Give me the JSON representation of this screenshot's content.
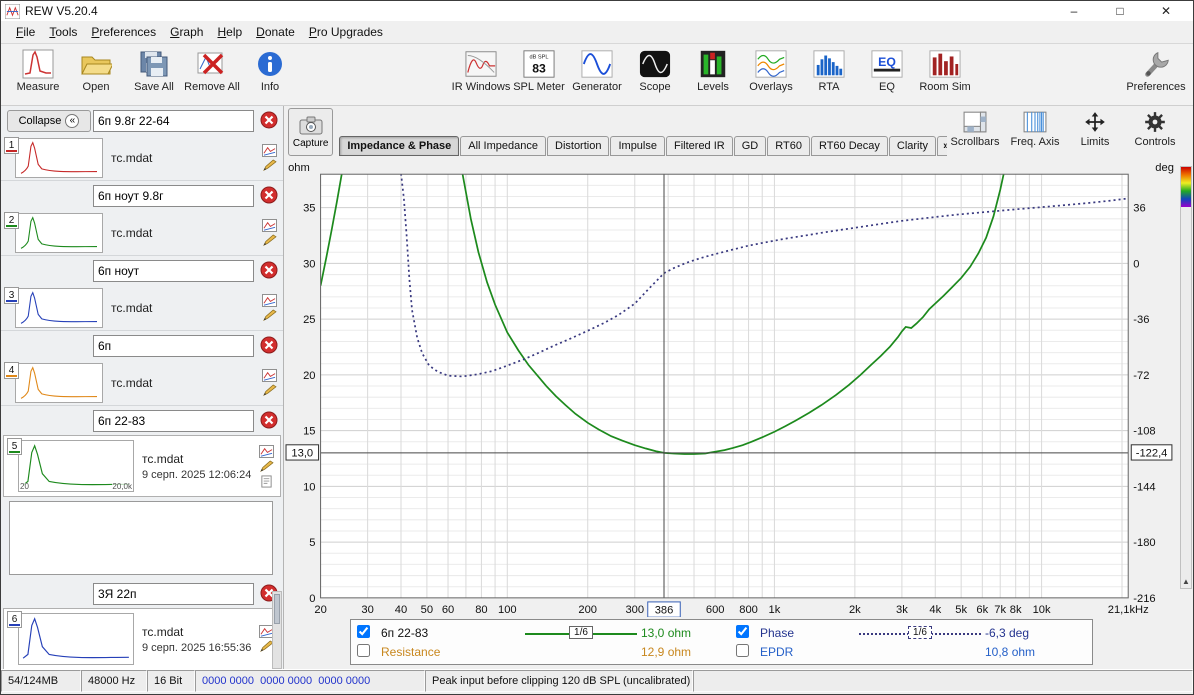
{
  "window": {
    "title": "REW V5.20.4",
    "minimize": "–",
    "maximize": "□",
    "close": "✕"
  },
  "menu": {
    "items": [
      "File",
      "Tools",
      "Preferences",
      "Graph",
      "Help",
      "Donate",
      "Pro Upgrades"
    ]
  },
  "toolbar": {
    "measure": "Measure",
    "open": "Open",
    "save_all": "Save All",
    "remove_all": "Remove All",
    "info": "Info",
    "ir_windows": "IR Windows",
    "spl_meter": "SPL Meter",
    "spl_meter_units": "dB SPL",
    "spl_meter_value": "83",
    "generator": "Generator",
    "scope": "Scope",
    "levels": "Levels",
    "overlays": "Overlays",
    "rta": "RTA",
    "eq": "EQ",
    "room_sim": "Room Sim",
    "preferences": "Preferences"
  },
  "sidebar": {
    "collapse": "Collapse",
    "collapse_icon": "«",
    "measurements": [
      {
        "num": "1",
        "name": "6п 9.8г 22-64",
        "file": "тс.mdat",
        "color": "#c62828"
      },
      {
        "num": "2",
        "name": "6п ноут 9.8г",
        "file": "тс.mdat",
        "color": "#1d8a1d"
      },
      {
        "num": "3",
        "name": "6п ноут",
        "file": "тс.mdat",
        "color": "#2640b8"
      },
      {
        "num": "4",
        "name": "6п",
        "file": "тс.mdat",
        "color": "#e08818"
      },
      {
        "num": "5",
        "name": "6п 22-83",
        "file": "тс.mdat",
        "date": "9 серп. 2025 12:06:24",
        "color": "#1d8a1d",
        "axis_left": "20",
        "axis_right": "20,0k"
      },
      {
        "num": "6",
        "name": "3Я 22п",
        "file": "тс.mdat",
        "date": "9 серп. 2025 16:55:36",
        "color": "#2640b8"
      }
    ]
  },
  "graph_toolbar": {
    "capture": "Capture",
    "tabs": [
      "Impedance & Phase",
      "All Impedance",
      "Distortion",
      "Impulse",
      "Filtered IR",
      "GD",
      "RT60",
      "RT60 Decay",
      "Clarity"
    ],
    "overflow": "»",
    "selected_tab": "Impedance & Phase",
    "right_buttons": [
      "Scrollbars",
      "Freq. Axis",
      "Limits",
      "Controls"
    ]
  },
  "legend": {
    "trace": "6п 22-83",
    "trace_checked": true,
    "trace_smoothing": "1/6",
    "trace_value": "13,0 ohm",
    "phase": "Phase",
    "phase_checked": true,
    "phase_smoothing": "1/6",
    "phase_value": "-6,3 deg",
    "resistance": "Resistance",
    "resistance_checked": false,
    "resistance_value": "12,9 ohm",
    "epdr": "EPDR",
    "epdr_checked": false,
    "epdr_value": "10,8 ohm"
  },
  "statusbar": {
    "memory": "54/124MB",
    "sample_rate": "48000 Hz",
    "bit_depth": "16 Bit",
    "input_levels": "0000 0000  0000 0000  0000 0000",
    "message": "Peak input before clipping 120 dB SPL (uncalibrated)"
  },
  "colors": {
    "impedance": "#1d8a1d",
    "phase": "#3a3a80",
    "phase-text": "#24348f",
    "resistance": "#c8871e",
    "epdr": "#2560c8",
    "accent-blue": "#2233cc"
  },
  "chart_data": {
    "type": "line",
    "title": "Impedance & Phase",
    "x_axis": {
      "scale": "log",
      "min": 20,
      "max": 21100,
      "ticks": [
        {
          "f": 20,
          "label": "20"
        },
        {
          "f": 30,
          "label": "30"
        },
        {
          "f": 40,
          "label": "40"
        },
        {
          "f": 50,
          "label": "50"
        },
        {
          "f": 60,
          "label": "60"
        },
        {
          "f": 80,
          "label": "80"
        },
        {
          "f": 100,
          "label": "100"
        },
        {
          "f": 200,
          "label": "200"
        },
        {
          "f": 300,
          "label": "300"
        },
        {
          "f": 600,
          "label": "600"
        },
        {
          "f": 800,
          "label": "800"
        },
        {
          "f": 1000,
          "label": "1k"
        },
        {
          "f": 2000,
          "label": "2k"
        },
        {
          "f": 3000,
          "label": "3k"
        },
        {
          "f": 4000,
          "label": "4k"
        },
        {
          "f": 5000,
          "label": "5k"
        },
        {
          "f": 6000,
          "label": "6k"
        },
        {
          "f": 7000,
          "label": "7k"
        },
        {
          "f": 8000,
          "label": "8k"
        },
        {
          "f": 10000,
          "label": "10k"
        },
        {
          "f": 21100,
          "label": "21,1kHz"
        }
      ]
    },
    "y_left": {
      "label": "ohm",
      "min": 0,
      "max": 38,
      "ticks": [
        0,
        5,
        10,
        15,
        20,
        25,
        30,
        35
      ]
    },
    "y_right": {
      "label": "deg",
      "ticks": [
        36,
        0,
        -36,
        -72,
        -108,
        -144,
        -180,
        -216
      ],
      "deg_per_ohm": 7.2,
      "zero_at_ohm": 30
    },
    "cursor": {
      "freq": 386,
      "freq_label": "386",
      "ohm": 13,
      "ohm_label": "13,0",
      "deg_label": "-122,4"
    },
    "series": [
      {
        "name": "6п 22-83 impedance",
        "units": "ohm",
        "color": "#1d8a1d",
        "style": "solid",
        "points": [
          [
            20,
            28
          ],
          [
            21,
            30.5
          ],
          [
            22,
            33
          ],
          [
            23,
            35.5
          ],
          [
            24,
            38
          ],
          [
            25,
            42
          ],
          [
            28,
            56
          ],
          [
            33,
            72
          ],
          [
            40,
            79
          ],
          [
            47,
            70
          ],
          [
            53,
            58
          ],
          [
            58,
            50
          ],
          [
            63,
            43
          ],
          [
            68,
            38
          ],
          [
            73,
            34
          ],
          [
            78,
            31
          ],
          [
            84,
            28.3
          ],
          [
            90,
            26.3
          ],
          [
            100,
            23.8
          ],
          [
            110,
            22.2
          ],
          [
            120,
            20.9
          ],
          [
            130,
            19.9
          ],
          [
            140,
            19
          ],
          [
            152,
            18.1
          ],
          [
            165,
            17.3
          ],
          [
            180,
            16.5
          ],
          [
            200,
            15.7
          ],
          [
            220,
            15.1
          ],
          [
            245,
            14.5
          ],
          [
            270,
            14.1
          ],
          [
            300,
            13.7
          ],
          [
            330,
            13.4
          ],
          [
            360,
            13.15
          ],
          [
            386,
            13
          ],
          [
            420,
            12.95
          ],
          [
            460,
            12.9
          ],
          [
            500,
            12.9
          ],
          [
            550,
            12.95
          ],
          [
            600,
            13.1
          ],
          [
            650,
            13.25
          ],
          [
            700,
            13.45
          ],
          [
            760,
            13.7
          ],
          [
            820,
            14
          ],
          [
            900,
            14.4
          ],
          [
            1000,
            14.9
          ],
          [
            1100,
            15.4
          ],
          [
            1200,
            15.9
          ],
          [
            1350,
            16.6
          ],
          [
            1500,
            17.3
          ],
          [
            1700,
            18.2
          ],
          [
            1900,
            19.1
          ],
          [
            2100,
            20
          ],
          [
            2300,
            20.9
          ],
          [
            2500,
            21.7
          ],
          [
            2700,
            22.5
          ],
          [
            2900,
            23.4
          ],
          [
            3000,
            23.9
          ],
          [
            3100,
            24.3
          ],
          [
            3250,
            24.2
          ],
          [
            3400,
            24.6
          ],
          [
            3600,
            25.2
          ],
          [
            3800,
            25.9
          ],
          [
            4000,
            26.4
          ],
          [
            4300,
            27.1
          ],
          [
            4600,
            27.8
          ],
          [
            5000,
            28.7
          ],
          [
            5400,
            29.7
          ],
          [
            5800,
            30.9
          ],
          [
            6200,
            32.3
          ],
          [
            6600,
            34.2
          ],
          [
            7000,
            36.6
          ],
          [
            7300,
            38.6
          ]
        ]
      },
      {
        "name": "6п 22-83 phase",
        "units": "deg",
        "color": "#3a3a80",
        "style": "dotted",
        "points": [
          [
            40,
            58
          ],
          [
            41,
            42
          ],
          [
            42,
            18
          ],
          [
            43,
            -10
          ],
          [
            44,
            -30
          ],
          [
            46,
            -48
          ],
          [
            48,
            -58
          ],
          [
            51,
            -66
          ],
          [
            55,
            -70
          ],
          [
            60,
            -72.5
          ],
          [
            68,
            -73
          ],
          [
            78,
            -71.5
          ],
          [
            88,
            -69.5
          ],
          [
            100,
            -66
          ],
          [
            115,
            -62
          ],
          [
            130,
            -58
          ],
          [
            150,
            -53
          ],
          [
            170,
            -49
          ],
          [
            200,
            -43.5
          ],
          [
            230,
            -38.5
          ],
          [
            260,
            -33.5
          ],
          [
            300,
            -26
          ],
          [
            340,
            -16
          ],
          [
            386,
            -6.3
          ],
          [
            420,
            -3
          ],
          [
            470,
            0.5
          ],
          [
            530,
            3.5
          ],
          [
            600,
            6
          ],
          [
            700,
            9
          ],
          [
            800,
            11.5
          ],
          [
            950,
            14
          ],
          [
            1100,
            16
          ],
          [
            1300,
            18
          ],
          [
            1600,
            20.5
          ],
          [
            2000,
            23
          ],
          [
            2500,
            25.5
          ],
          [
            3000,
            27.5
          ],
          [
            3800,
            29.5
          ],
          [
            4800,
            31.5
          ],
          [
            6000,
            33
          ],
          [
            7500,
            34.5
          ],
          [
            9500,
            36
          ],
          [
            12000,
            37.5
          ],
          [
            15000,
            39
          ],
          [
            18000,
            40.5
          ],
          [
            21100,
            42
          ]
        ]
      }
    ]
  }
}
